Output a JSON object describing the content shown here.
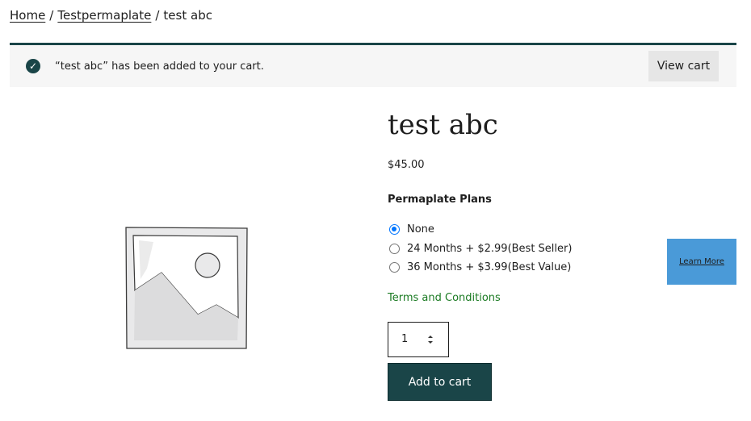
{
  "breadcrumb": {
    "home": "Home",
    "category": "Testpermaplate",
    "current": "test abc",
    "separator": "/"
  },
  "notice": {
    "message": "“test abc” has been added to your cart.",
    "button_label": "View cart",
    "icon": "check-circle-icon"
  },
  "product": {
    "title": "test abc",
    "price": "$45.00",
    "plans_label": "Permaplate Plans",
    "plans": [
      {
        "label": "None",
        "selected": true
      },
      {
        "label": "24 Months + $2.99(Best Seller)",
        "selected": false
      },
      {
        "label": "36 Months + $3.99(Best Value)",
        "selected": false
      }
    ],
    "terms_link": "Terms and Conditions",
    "quantity": "1",
    "add_to_cart_label": "Add to cart",
    "learn_more_label": "Learn More",
    "image_icon": "image-placeholder-icon"
  },
  "colors": {
    "brand": "#1a4548",
    "notice_bg": "#f6f6f6",
    "terms_link": "#1a7a22",
    "learn_more_bg": "#4a9ad8",
    "radio_selected": "#0075ff"
  }
}
